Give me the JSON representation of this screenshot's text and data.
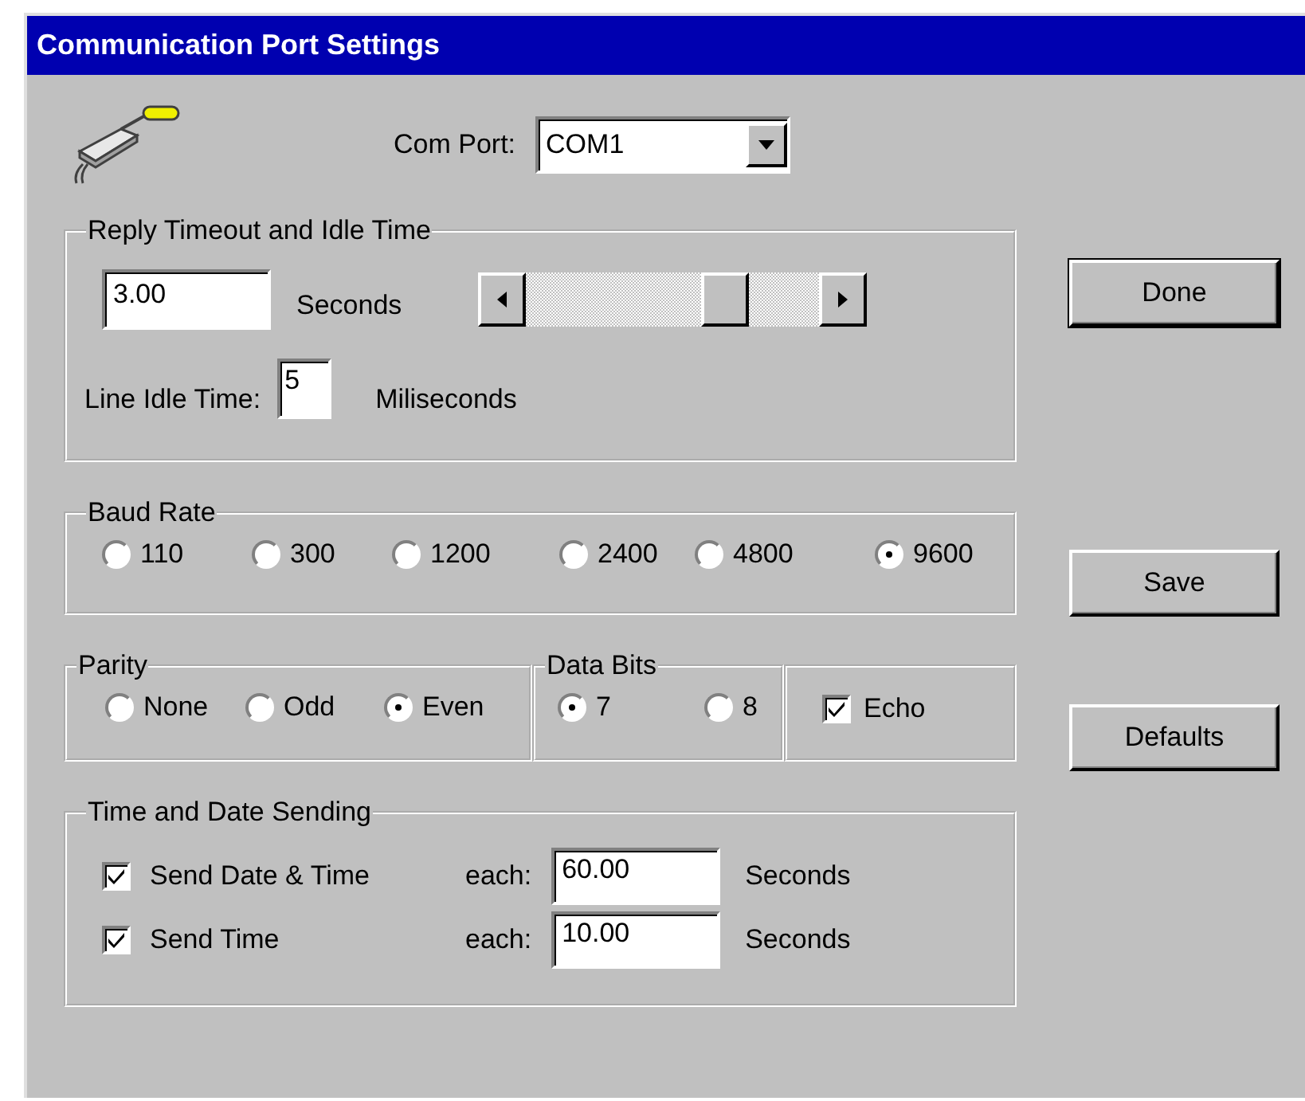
{
  "window": {
    "title": "Communication Port Settings"
  },
  "com_port": {
    "label": "Com Port:",
    "value": "COM1"
  },
  "reply_timeout": {
    "title": "Reply Timeout and Idle Time",
    "timeout": {
      "value": "3.00",
      "unit": "Seconds"
    },
    "slider": {
      "level": 0.71
    },
    "idle": {
      "label": "Line Idle Time:",
      "value": "5",
      "unit": "Miliseconds"
    }
  },
  "baud_rate": {
    "title": "Baud Rate",
    "options": [
      {
        "label": "110",
        "selected": false
      },
      {
        "label": "300",
        "selected": false
      },
      {
        "label": "1200",
        "selected": false
      },
      {
        "label": "2400",
        "selected": false
      },
      {
        "label": "4800",
        "selected": false
      },
      {
        "label": "9600",
        "selected": true
      }
    ]
  },
  "parity": {
    "title": "Parity",
    "options": [
      {
        "label": "None",
        "selected": false
      },
      {
        "label": "Odd",
        "selected": false
      },
      {
        "label": "Even",
        "selected": true
      }
    ]
  },
  "data_bits": {
    "title": "Data Bits",
    "options": [
      {
        "label": "7",
        "selected": true
      },
      {
        "label": "8",
        "selected": false
      }
    ]
  },
  "echo": {
    "label": "Echo",
    "checked": true
  },
  "time_date_sending": {
    "title": "Time and Date Sending",
    "rows": [
      {
        "label": "Send Date & Time",
        "checked": true,
        "each_label": "each:",
        "value": "60.00",
        "unit": "Seconds"
      },
      {
        "label": "Send Time",
        "checked": true,
        "each_label": "each:",
        "value": "10.00",
        "unit": "Seconds"
      }
    ]
  },
  "buttons": [
    {
      "label": "Done",
      "default": true
    },
    {
      "label": "Save",
      "default": false
    },
    {
      "label": "Defaults",
      "default": false
    }
  ]
}
